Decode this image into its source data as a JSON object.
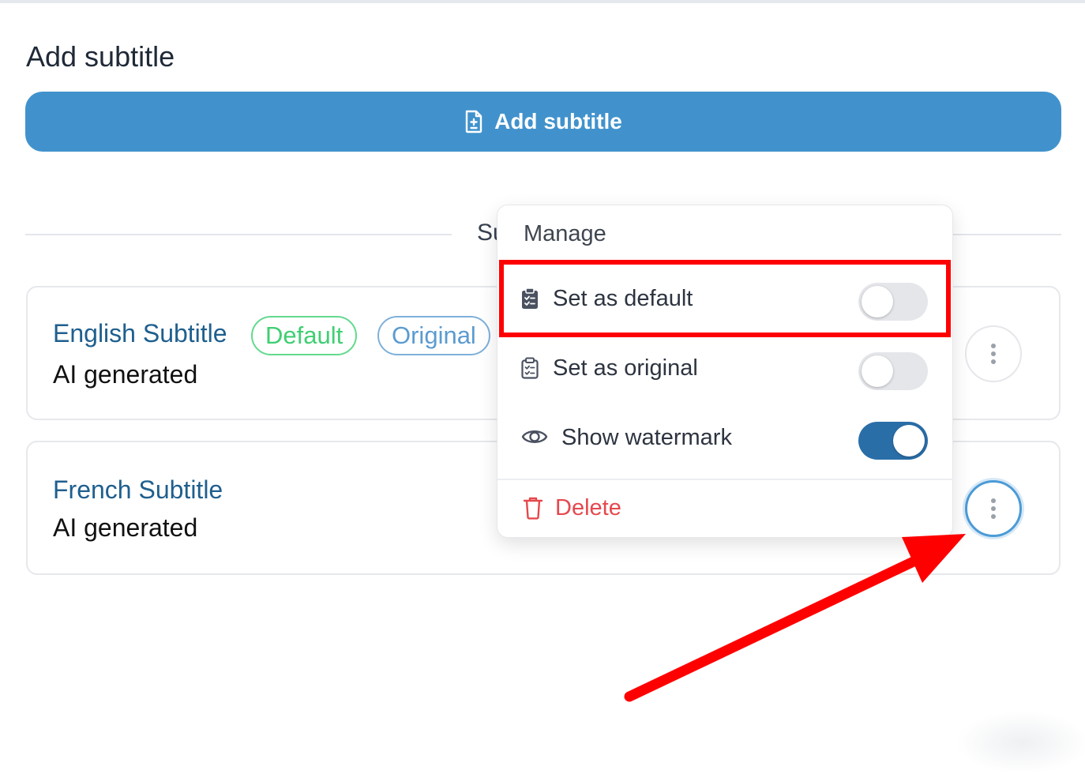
{
  "page": {
    "section_title": "Add subtitle",
    "add_button_label": "Add subtitle",
    "divider_label": "Su"
  },
  "subtitles": [
    {
      "name": "English Subtitle",
      "meta": "AI generated",
      "badges": [
        "Default",
        "Original"
      ]
    },
    {
      "name": "French Subtitle",
      "meta": "AI generated"
    }
  ],
  "menu": {
    "header": "Manage",
    "items": {
      "set_default": {
        "label": "Set as default",
        "toggle": false
      },
      "set_original": {
        "label": "Set as original",
        "toggle": false
      },
      "show_watermark": {
        "label": "Show watermark",
        "toggle": true
      }
    },
    "delete_label": "Delete"
  },
  "colors": {
    "primary": "#4192cc",
    "default_badge": "#3fcf72",
    "original_badge": "#5b9bd0",
    "toggle_on": "#2a6ea8",
    "danger": "#e5484d",
    "annotation": "#ff0000"
  },
  "icons": {
    "add_button": "document-plus-icon",
    "set_default": "clipboard-check-icon",
    "set_original": "clipboard-list-icon",
    "show_watermark": "eye-icon",
    "delete": "trash-icon",
    "row_actions": "vertical-dots-icon"
  }
}
